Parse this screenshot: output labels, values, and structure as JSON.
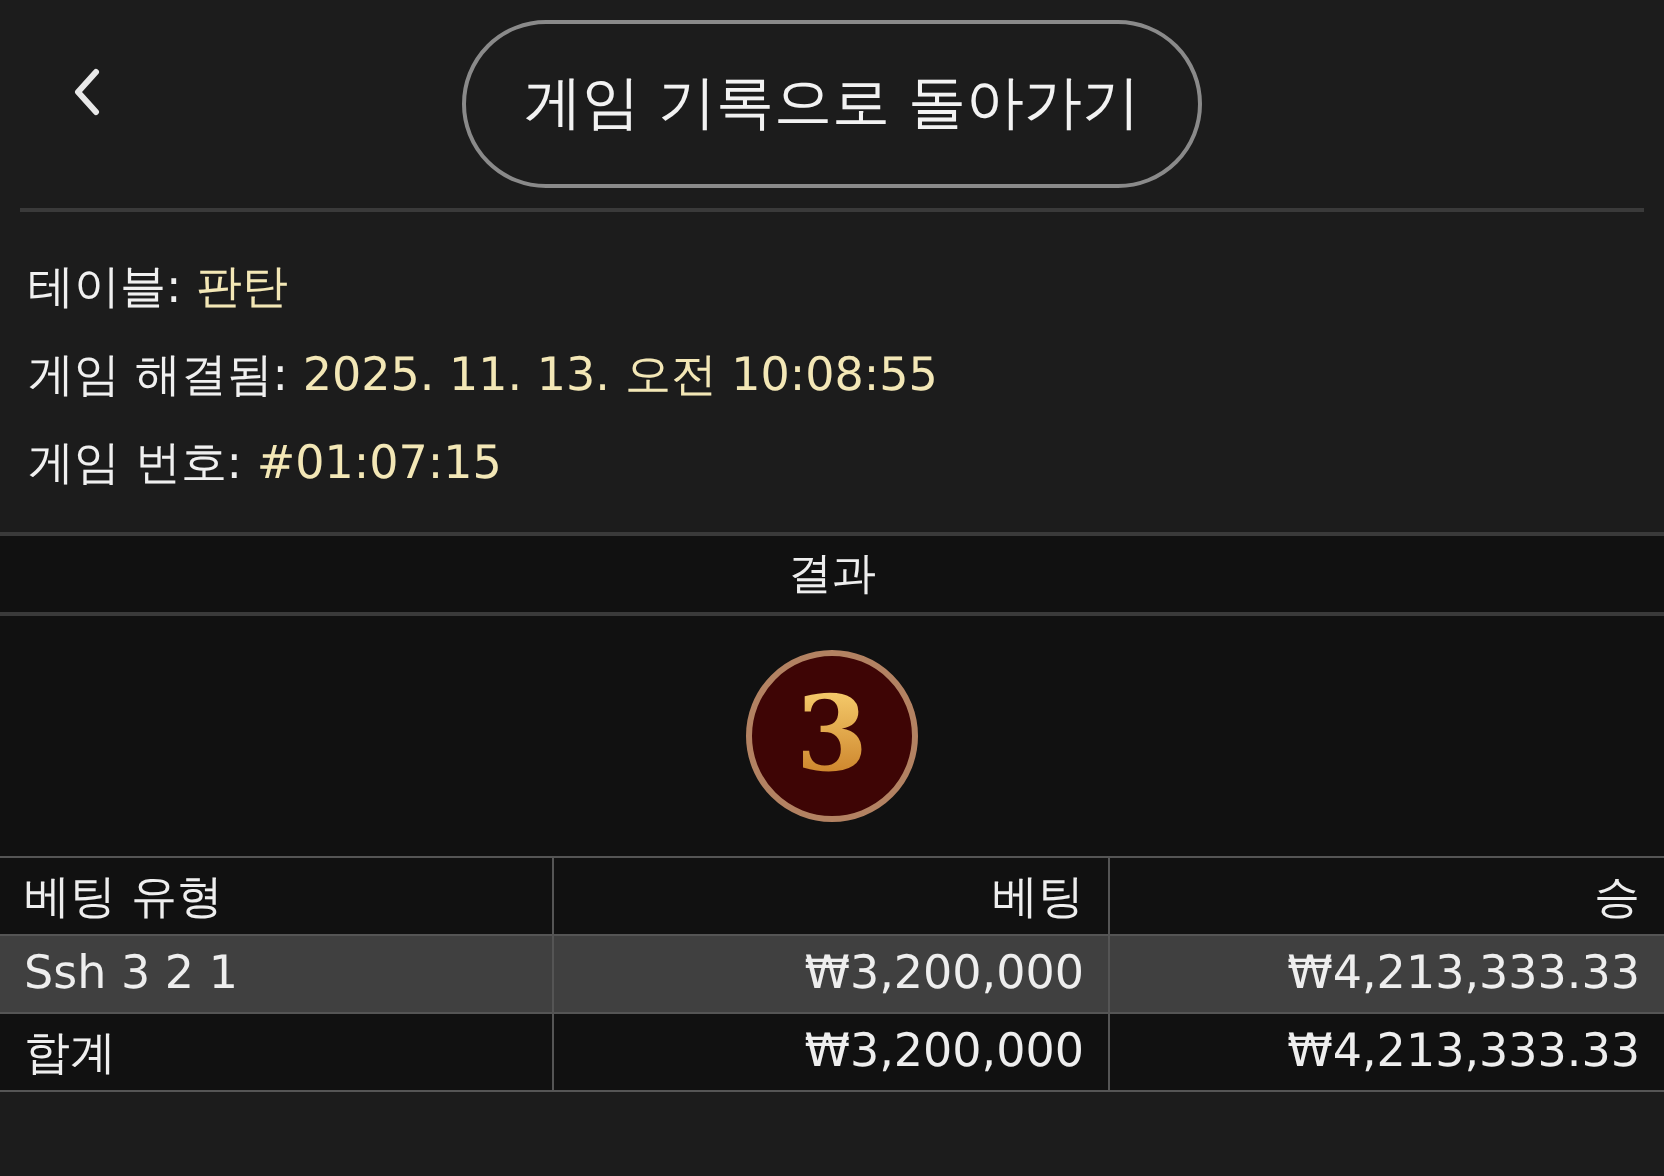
{
  "header": {
    "title_button": "게임 기록으로 돌아가기"
  },
  "info": [
    {
      "label": "테이블:",
      "value": "판탄"
    },
    {
      "label": "게임 해결됨:",
      "value": "2025. 11. 13. 오전 10:08:55"
    },
    {
      "label": "게임 번호:",
      "value": "#01:07:15"
    }
  ],
  "result": {
    "heading": "결과",
    "number": "3"
  },
  "table": {
    "columns": [
      "베팅 유형",
      "베팅",
      "승"
    ],
    "rows": [
      {
        "kind": "bet",
        "cells": [
          "Ssh 3 2 1",
          "₩3,200,000",
          "₩4,213,333.33"
        ]
      },
      {
        "kind": "total",
        "cells": [
          "합계",
          "₩3,200,000",
          "₩4,213,333.33"
        ]
      }
    ]
  }
}
